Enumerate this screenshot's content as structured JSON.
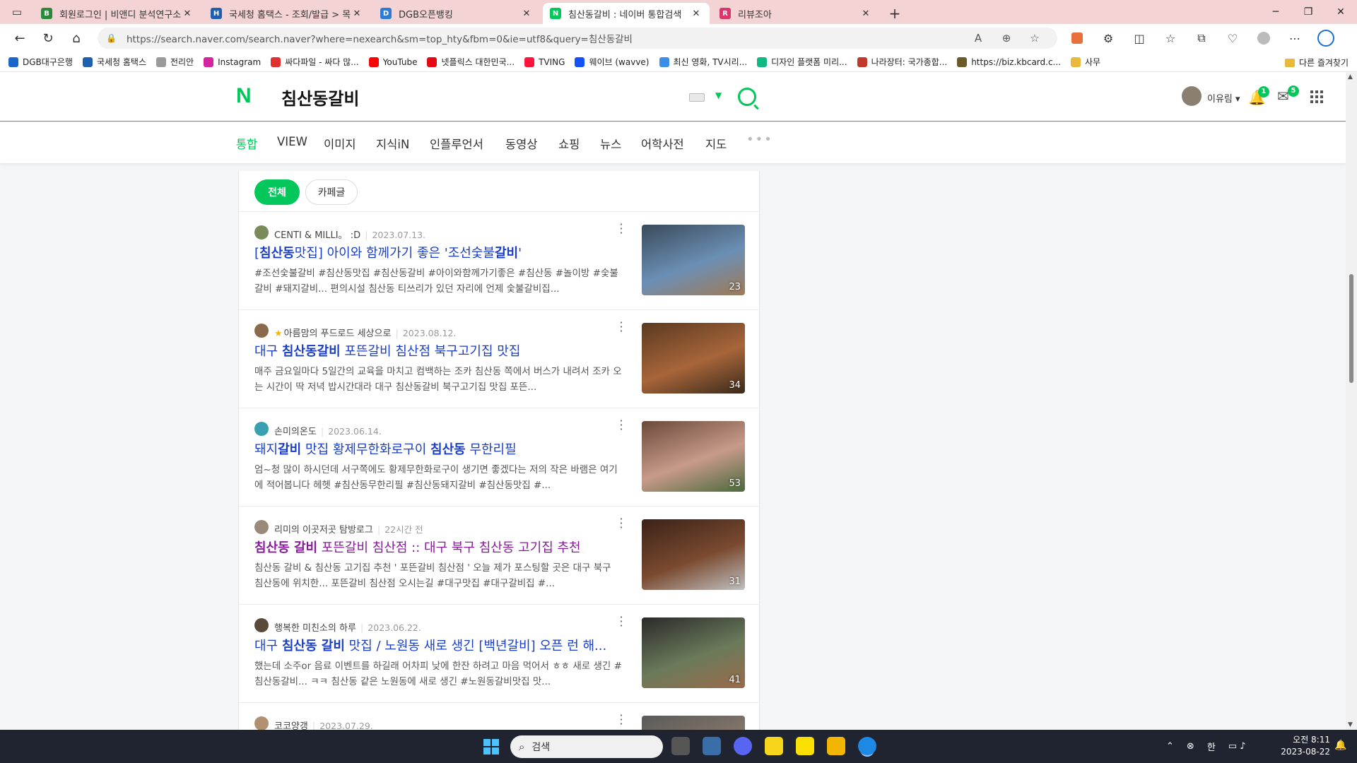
{
  "browser": {
    "tabs": [
      {
        "title": "회원로그인 | 비앤디 분석연구소",
        "favicon_color": "#2a8a3a",
        "favicon_char": "B",
        "active": false
      },
      {
        "title": "국세청 홈택스 - 조회/발급 > 목록",
        "favicon_color": "#1f5fb0",
        "favicon_char": "H",
        "active": false
      },
      {
        "title": "DGB오픈뱅킹",
        "favicon_color": "#2d7bd6",
        "favicon_char": "D",
        "active": false
      },
      {
        "title": "침산동갈비 : 네이버 통합검색",
        "favicon_color": "#03c75a",
        "favicon_char": "N",
        "active": true
      },
      {
        "title": "리뷰조아",
        "favicon_color": "#d9366b",
        "favicon_char": "R",
        "active": false
      }
    ],
    "new_tab": "+",
    "url": "https://search.naver.com/search.naver?where=nexearch&sm=top_hty&fbm=0&ie=utf8&query=침산동갈비",
    "bookmarks": [
      {
        "label": "DGB대구은행",
        "color": "#1a66c9"
      },
      {
        "label": "국세청 홈택스",
        "color": "#1f5fb0"
      },
      {
        "label": "전리안",
        "color": "#9a9a9a"
      },
      {
        "label": "Instagram",
        "color": "#d6249f"
      },
      {
        "label": "싸다파일 - 싸다 많...",
        "color": "#e03030"
      },
      {
        "label": "YouTube",
        "color": "#ff0000"
      },
      {
        "label": "넷플릭스 대한민국...",
        "color": "#e50914"
      },
      {
        "label": "TVING",
        "color": "#ff153c"
      },
      {
        "label": "웨이브 (wavve)",
        "color": "#1351f9"
      },
      {
        "label": "최신 영화, TV시리...",
        "color": "#3a8ee6"
      },
      {
        "label": "디자인 플랫폼 미리...",
        "color": "#10b981"
      },
      {
        "label": "나라장터: 국가종합...",
        "color": "#c0392b"
      },
      {
        "label": "https://biz.kbcard.c...",
        "color": "#6b5a2a"
      },
      {
        "label": "사무",
        "color": "#e8b93a"
      }
    ],
    "other_bookmarks": "다른 즐겨찾기"
  },
  "naver": {
    "logo": "N",
    "query": "침산동갈비",
    "user_name": "이유림",
    "notif_count": "1",
    "mail_count": "5",
    "nav": [
      "통합",
      "VIEW",
      "이미지",
      "지식iN",
      "인플루언서",
      "동영상",
      "쇼핑",
      "뉴스",
      "어학사전",
      "지도"
    ],
    "more": "•••",
    "filters": [
      "전체",
      "카페글"
    ],
    "results": [
      {
        "author": "CENTI & MILLI。 :D",
        "date": "2023.07.13.",
        "title_html_parts": [
          "[",
          "침산동",
          "맛집] 아이와 함께가기 좋은 '조선숯불",
          "갈비",
          "'"
        ],
        "desc": "#조선숯불갈비 #침산동맛집 #침산동갈비 #아이와함께가기좋은 #침산동 #놀이방 #숯불갈비 #돼지갈비... 편의시설 침산동 티쓰리가 있던 자리에 언제 숯불갈비집...",
        "count": "23",
        "visited": false,
        "avatar": "#7a8a5a",
        "thumb": [
          "#3a4a5a",
          "#6b8fb5",
          "#a07a55"
        ]
      },
      {
        "author": "아름맘의 푸드로드 세상으로",
        "date": "2023.08.12.",
        "title_html_parts": [
          "대구 ",
          "침산동갈비",
          " 포뜬갈비 침산점 북구고기집 맛집"
        ],
        "desc": "매주 금요일마다 5일간의 교육을 마치고 컴백하는 조카 침산동 쪽에서 버스가 내려서 조카 오는 시간이 딱 저녁 밥시간대라 대구 침산동갈비 북구고기집 맛집 포뜬...",
        "count": "34",
        "visited": false,
        "avatar": "#8a6a4a",
        "thumb": [
          "#5a3a20",
          "#a8653a",
          "#3a2a1a"
        ]
      },
      {
        "author": "손미의온도",
        "date": "2023.06.14.",
        "title_html_parts": [
          "돼지",
          "갈비",
          " 맛집 황제무한화로구이 ",
          "침산동",
          " 무한리필"
        ],
        "desc": "엄~청 많이 하시던데 서구쪽에도 황제무한화로구이 생기면 좋겠다는 저의 작은 바램은 여기에 적어봅니다 헤헷 #침산동무한리필 #침산동돼지갈비 #침산동맛집 #...",
        "count": "53",
        "visited": false,
        "avatar": "#3aa0b0",
        "thumb": [
          "#6a4a3a",
          "#c89a8a",
          "#4a6a3a"
        ]
      },
      {
        "author": "리미의 이곳저곳 탐방로그",
        "date": "22시간 전",
        "title_html_parts": [
          "",
          "침산동 갈비",
          " 포뜬갈비 침산점 :: 대구 북구 침산동 고기집 추천"
        ],
        "desc": "침산동 갈비 & 침산동 고기집 추천 ' 포뜬갈비 침산점 ' 오늘 제가 포스팅할 곳은 대구 북구 침산동에 위치한... 포뜬갈비 침산점 오시는길 #대구맛집 #대구갈비집 #...",
        "count": "31",
        "visited": true,
        "avatar": "#9a8a7a",
        "thumb": [
          "#3a2218",
          "#7a4a30",
          "#c0c0c0"
        ]
      },
      {
        "author": "행복한 미친소의 하루",
        "date": "2023.06.22.",
        "title_html_parts": [
          "대구 ",
          "침산동 갈비",
          " 맛집 / 노원동 새로 생긴 [백년갈비] 오픈 런 해..."
        ],
        "desc": "했는데 소주or 음료 이벤트를 하길래 어차피 낮에 한잔 하려고 마음 먹어서 ㅎㅎ 새로 생긴 #침산동갈비... ㅋㅋ 침산동 같은 노원동에 새로 생긴 #노원동갈비맛집 맛...",
        "count": "41",
        "visited": false,
        "avatar": "#5a4a3a",
        "thumb": [
          "#2a2a2a",
          "#6a7a5a",
          "#9a6a4a"
        ]
      },
      {
        "author": "코코양갱",
        "date": "2023.07.29.",
        "title_html_parts": [
          "",
          "",
          ""
        ],
        "desc": "",
        "count": "",
        "visited": false,
        "avatar": "#b09070",
        "thumb": [
          "#5a5a5a",
          "#8a7a6a",
          "#aaaaaa"
        ]
      }
    ]
  },
  "taskbar": {
    "search_placeholder": "검색",
    "ime": "한",
    "time": "오전 8:11",
    "date": "2023-08-22"
  }
}
